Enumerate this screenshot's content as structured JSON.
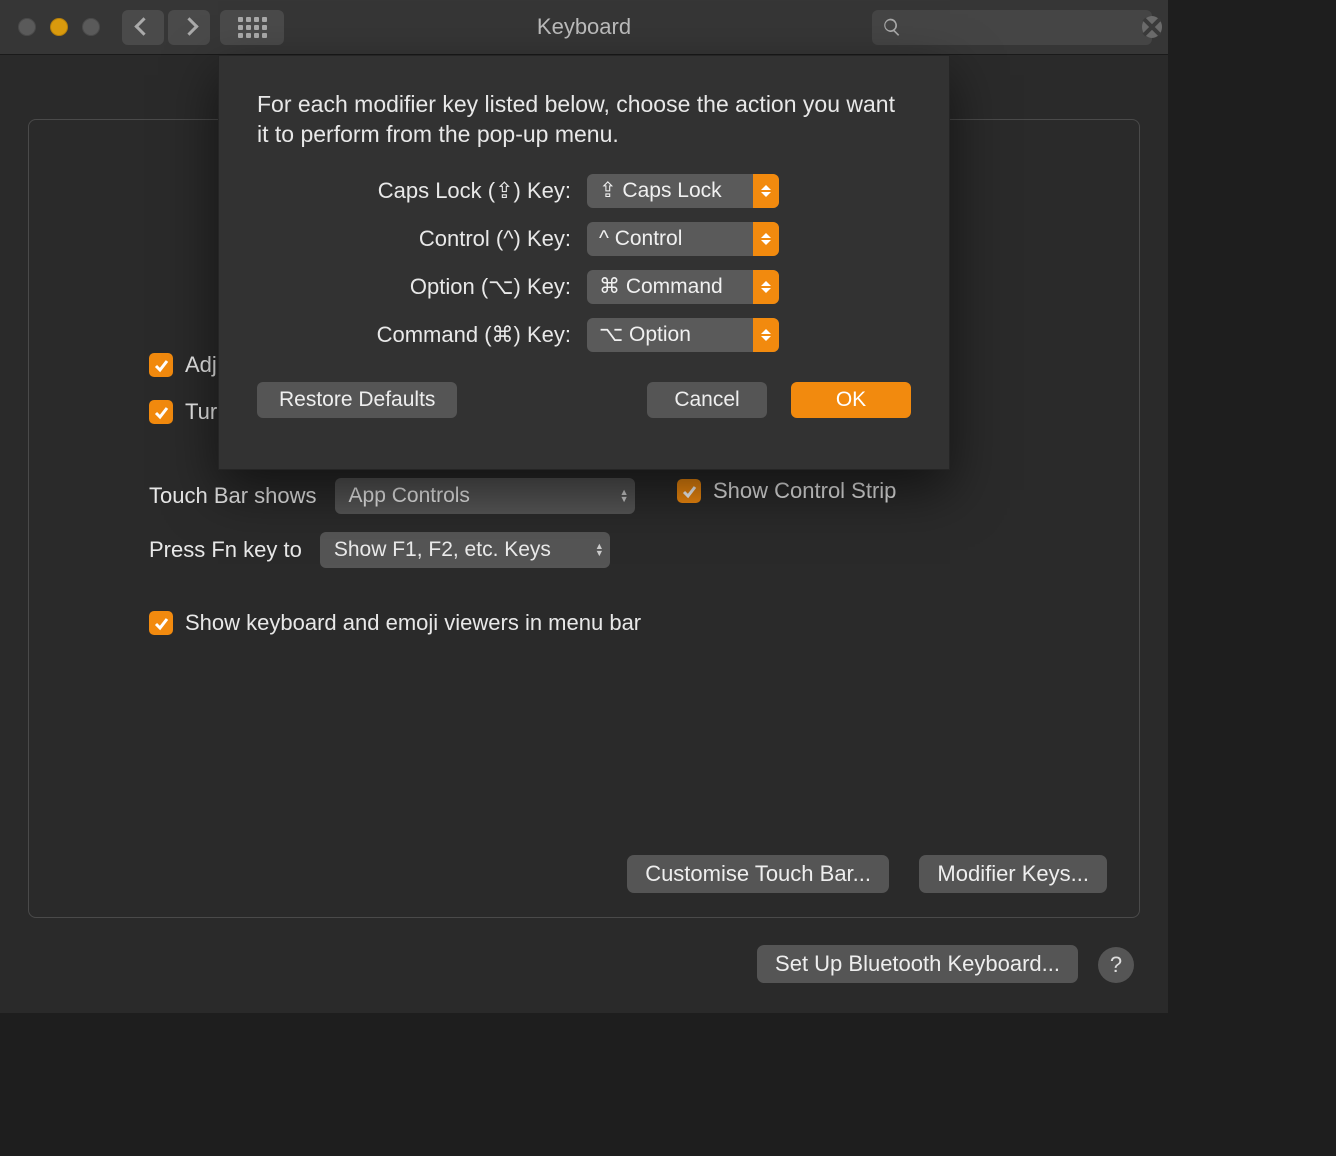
{
  "titlebar": {
    "title": "Keyboard",
    "search_placeholder": ""
  },
  "panel": {
    "adj_label": "Adj",
    "tur_label": "Tur",
    "touch_bar_label": "Touch Bar shows",
    "touch_bar_value": "App Controls",
    "show_control_strip_label": "Show Control Strip",
    "press_fn_label": "Press Fn key to",
    "press_fn_value": "Show F1, F2, etc. Keys",
    "show_keyboard_label": "Show keyboard and emoji viewers in menu bar",
    "customise_touch_bar": "Customise Touch Bar...",
    "modifier_keys": "Modifier Keys..."
  },
  "footer": {
    "setup_bt": "Set Up Bluetooth Keyboard...",
    "help": "?"
  },
  "sheet": {
    "description": "For each modifier key listed below, choose the action you want it to perform from the pop-up menu.",
    "rows": [
      {
        "label": "Caps Lock (⇪) Key:",
        "value": "⇪ Caps Lock"
      },
      {
        "label": "Control (^) Key:",
        "value": "^ Control"
      },
      {
        "label": "Option (⌥) Key:",
        "value": "⌘ Command"
      },
      {
        "label": "Command (⌘) Key:",
        "value": "⌥ Option"
      }
    ],
    "restore": "Restore Defaults",
    "cancel": "Cancel",
    "ok": "OK"
  }
}
